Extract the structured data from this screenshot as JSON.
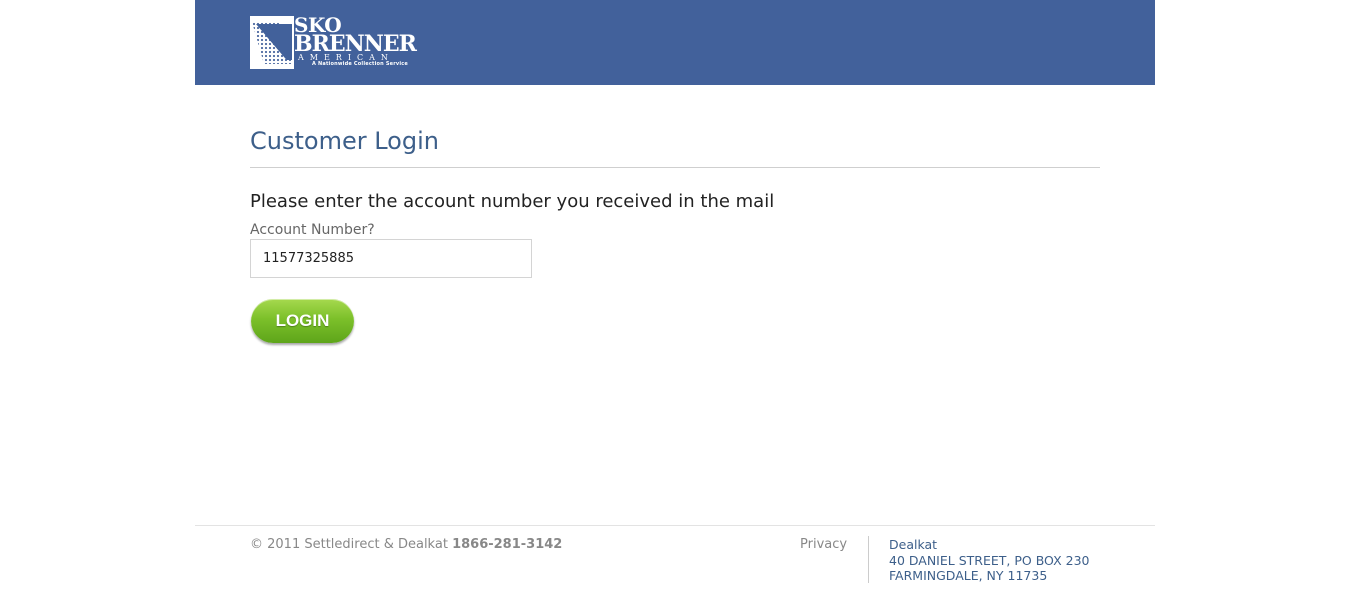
{
  "header": {
    "brand": {
      "line1": "SKO",
      "line2": "BRENNER",
      "line3": "AMERICAN",
      "tagline": "A Nationwide Collection Service"
    },
    "background_color": "#42619b"
  },
  "login": {
    "title": "Customer Login",
    "instruction": "Please enter the account number you received in the mail",
    "account_label": "Account Number?",
    "account_value": "11577325885",
    "button_label": "LOGIN",
    "button_color": "#7cc02a"
  },
  "footer": {
    "copyright": "© 2011 Settledirect & Dealkat",
    "phone": "1866-281-3142",
    "privacy_label": "Privacy",
    "address": {
      "name": "Dealkat",
      "street": "40 DANIEL STREET, PO BOX 230",
      "city": "FARMINGDALE, NY 11735"
    }
  }
}
